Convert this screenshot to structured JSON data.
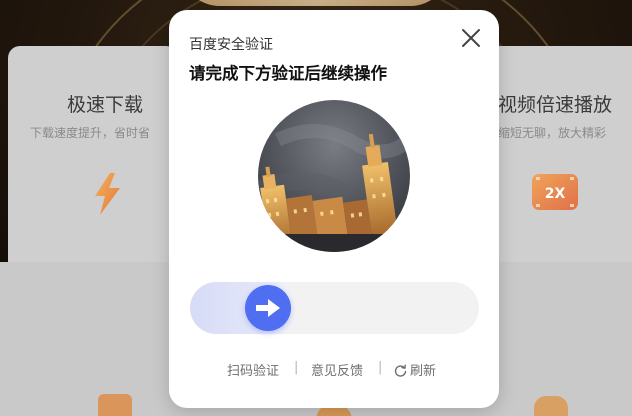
{
  "background": {
    "features": [
      {
        "title": "极速下载",
        "description": "下载速度提升，省时省",
        "icon": "lightning-icon"
      },
      {
        "title": "视频倍速播放",
        "description": "缩短无聊，放大精彩",
        "icon": "2x-speed-icon",
        "badge": "2X"
      }
    ]
  },
  "modal": {
    "brand": "百度安全验证",
    "title": "请完成下方验证后继续操作",
    "close_icon": "close-icon",
    "captcha_image": "rotated-night-city-photo",
    "slider": {
      "progress": 0.33,
      "handle_icon": "arrow-right-icon",
      "accent": "#4f6ef2"
    },
    "footer": {
      "scan": "扫码验证",
      "feedback": "意见反馈",
      "refresh": "刷新",
      "separator": "|"
    }
  }
}
